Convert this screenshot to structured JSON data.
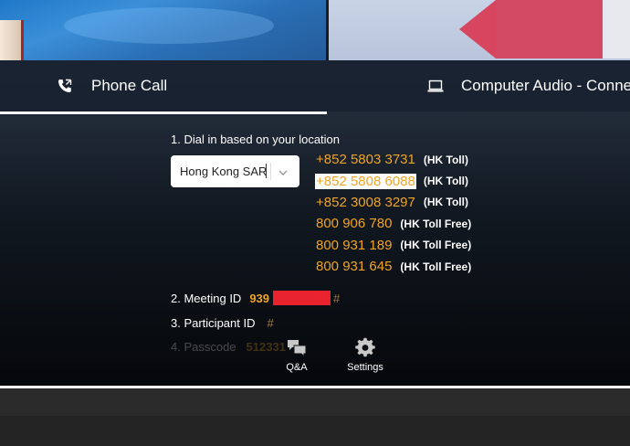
{
  "tabs": {
    "phone_call": "Phone Call",
    "computer_audio": "Computer Audio - Conne"
  },
  "dial_in": {
    "step1_label": "1. Dial in based on your location",
    "country_selected": "Hong Kong SAR",
    "numbers": [
      {
        "number": "+852 5803 3731",
        "tag": "(HK Toll)"
      },
      {
        "number": "+852 5808 6088",
        "tag": "(HK Toll)"
      },
      {
        "number": "+852 3008 3297",
        "tag": "(HK Toll)"
      },
      {
        "number": "800 906 780",
        "tag": "(HK Toll Free)"
      },
      {
        "number": "800 931 189",
        "tag": "(HK Toll Free)"
      },
      {
        "number": "800 931 645",
        "tag": "(HK Toll Free)"
      }
    ],
    "selected_number_index": 1
  },
  "meeting": {
    "step2_label": "2. Meeting ID",
    "meeting_id_visible": "939",
    "hash": "#",
    "step3_label": "3. Participant ID",
    "step4_label": "4. Passcode",
    "passcode_visible": "512331"
  },
  "toolbar": {
    "qa_label": "Q&A",
    "settings_label": "Settings"
  },
  "colors": {
    "accent_number": "#f0a425",
    "redaction": "#e8232d",
    "panel_top": "#2a3545",
    "panel_bottom": "#05070a"
  },
  "icons": {
    "phone": "phone-call-icon",
    "computer": "laptop-icon",
    "qa": "chat-bubbles-icon",
    "settings": "gear-icon",
    "dropdown": "chevron-down-icon"
  }
}
